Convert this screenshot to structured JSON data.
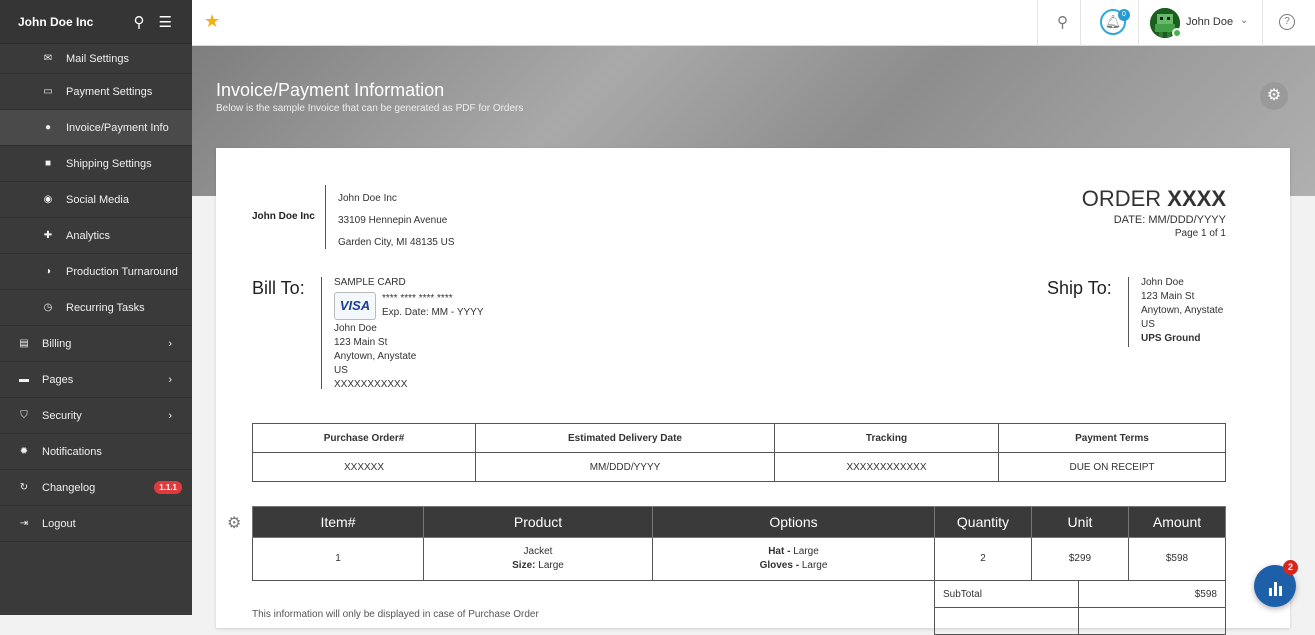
{
  "sidebar": {
    "brand": "John Doe Inc",
    "header_icons": [
      "search-icon",
      "menu-icon"
    ],
    "items": [
      {
        "label": "Mail Settings",
        "icon": "mail-icon",
        "sub": true
      },
      {
        "label": "Payment Settings",
        "icon": "card-icon",
        "sub": true
      },
      {
        "label": "Invoice/Payment Info",
        "icon": "info-icon",
        "sub": true,
        "active": true
      },
      {
        "label": "Shipping Settings",
        "icon": "truck-icon",
        "sub": true
      },
      {
        "label": "Social Media",
        "icon": "globe-icon",
        "sub": true
      },
      {
        "label": "Analytics",
        "icon": "puzzle-icon",
        "sub": true
      },
      {
        "label": "Production Turnaround",
        "icon": "gauge-icon",
        "sub": true
      },
      {
        "label": "Recurring Tasks",
        "icon": "clock-icon",
        "sub": true
      },
      {
        "label": "Billing",
        "icon": "billing-icon",
        "chevron": true
      },
      {
        "label": "Pages",
        "icon": "pages-icon",
        "chevron": true
      },
      {
        "label": "Security",
        "icon": "shield-icon",
        "chevron": true
      },
      {
        "label": "Notifications",
        "icon": "bug-icon"
      },
      {
        "label": "Changelog",
        "icon": "changelog-icon",
        "badge": "1.1.1"
      },
      {
        "label": "Logout",
        "icon": "logout-icon"
      }
    ]
  },
  "topbar": {
    "notification_count": "0",
    "user_name": "John Doe"
  },
  "banner": {
    "title": "Invoice/Payment Information",
    "subtitle": "Below is the sample Invoice that can be generated as PDF for Orders"
  },
  "invoice": {
    "company": {
      "name": "John Doe Inc",
      "address": [
        "John Doe Inc",
        "33109 Hennepin Avenue",
        "Garden City, MI 48135 US"
      ]
    },
    "order": {
      "prefix": "ORDER",
      "number": "XXXX",
      "date": "DATE: MM/DDD/YYYY",
      "page": "Page 1 of 1"
    },
    "bill_to": {
      "label": "Bill To:",
      "card_name": "SAMPLE CARD",
      "card_brand": "VISA",
      "card_number": "**** **** **** ****",
      "card_exp": "Exp. Date: MM - YYYY",
      "name": "John Doe",
      "street": "123 Main St",
      "city": "Anytown, Anystate",
      "country": "US",
      "phone": "XXXXXXXXXXX"
    },
    "ship_to": {
      "label": "Ship To:",
      "name": "John Doe",
      "street": "123 Main St",
      "city": "Anytown, Anystate",
      "country": "US",
      "method": "UPS Ground"
    },
    "order_info": {
      "headers": [
        "Purchase Order#",
        "Estimated Delivery Date",
        "Tracking",
        "Payment Terms"
      ],
      "values": [
        "XXXXXX",
        "MM/DDD/YYYY",
        "XXXXXXXXXXXX",
        "DUE ON RECEIPT"
      ]
    },
    "items": {
      "headers": [
        "Item#",
        "Product",
        "Options",
        "Quantity",
        "Unit",
        "Amount"
      ],
      "rows": [
        {
          "item": "1",
          "product": "Jacket",
          "size_label": "Size:",
          "size": "Large",
          "opt1_label": "Hat -",
          "opt1": "Large",
          "opt2_label": "Gloves -",
          "opt2": "Large",
          "quantity": "2",
          "unit": "$299",
          "amount": "$598"
        }
      ]
    },
    "subtotal_label": "SubTotal",
    "subtotal_value": "$598",
    "note": "This information will only be displayed in case of Purchase Order"
  },
  "chat": {
    "badge": "2"
  }
}
